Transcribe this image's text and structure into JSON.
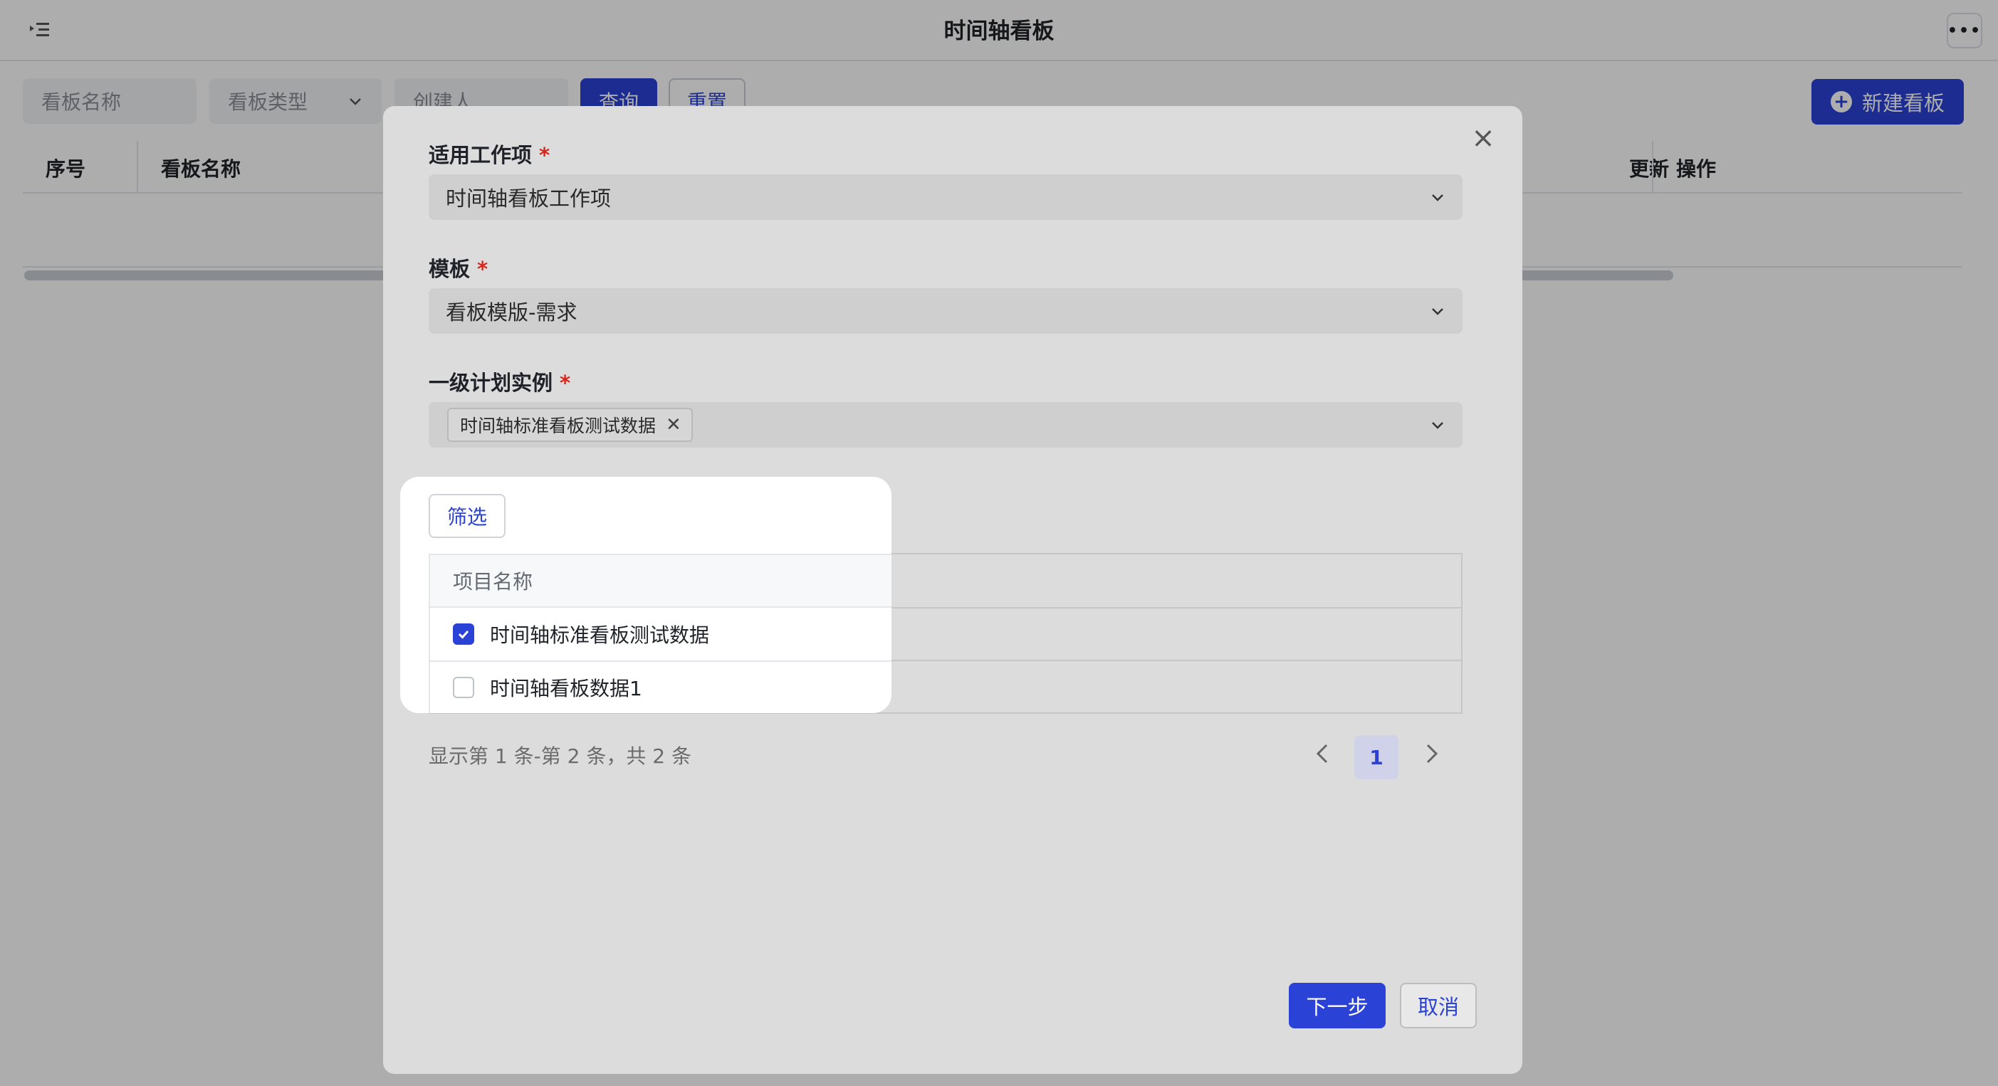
{
  "header": {
    "title": "时间轴看板",
    "menu_icon": "menu-toggle-icon",
    "more_icon": "more-icon"
  },
  "filters": {
    "name_placeholder": "看板名称",
    "type_placeholder": "看板类型",
    "creator_placeholder": "创建人",
    "query_label": "查询",
    "reset_label": "重置"
  },
  "actions": {
    "new_board_label": "新建看板"
  },
  "board_table": {
    "columns": [
      "序号",
      "看板名称",
      "更新",
      "操作"
    ]
  },
  "modal": {
    "work_item": {
      "label": "适用工作项",
      "value": "时间轴看板工作项"
    },
    "template": {
      "label": "模板",
      "value": "看板模版-需求"
    },
    "plan_instance": {
      "label": "一级计划实例",
      "tags": [
        "时间轴标准看板测试数据"
      ]
    },
    "filter_button": "筛选",
    "project_table": {
      "header": "项目名称",
      "rows": [
        {
          "name": "时间轴标准看板测试数据",
          "checked": true
        },
        {
          "name": "时间轴看板数据1",
          "checked": false
        }
      ]
    },
    "pagination": {
      "summary": "显示第 1 条-第 2 条，共 2 条",
      "current_page": "1"
    },
    "next_button": "下一步",
    "cancel_button": "取消"
  },
  "colors": {
    "primary": "#2b42d6",
    "required": "#d9261c"
  }
}
